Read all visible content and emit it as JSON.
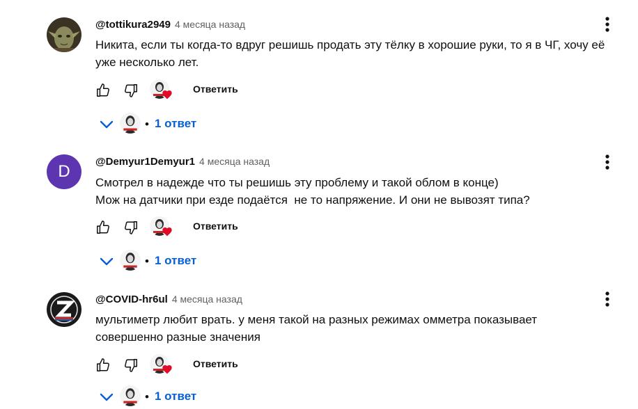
{
  "comments": [
    {
      "author": "@tottikura2949",
      "time": "4 месяца назад",
      "text": "Никита, если ты когда-то вдруг решишь продать эту тёлку в хорошие руки, то я в ЧГ, хочу её\nуже несколько лет.",
      "reply_label": "Ответить",
      "replies_label": "1 ответ",
      "avatar_icon": "yoda-avatar-icon"
    },
    {
      "author": "@Demyur1Demyur1",
      "time": "4 месяца назад",
      "text": "Смотрел в надежде что ты решишь эту проблему и такой облом в конце)\nМож на датчики при езде подаётся  не то напряжение. И они не вывозят типа?",
      "reply_label": "Ответить",
      "replies_label": "1 ответ",
      "avatar_letter": "D",
      "avatar_color": "#5e35b1"
    },
    {
      "author": "@COVID-hr6ul",
      "time": "4 месяца назад",
      "text": "мультиметр любит врать. у меня такой на разных режимах омметра показывает\nсовершенно разные значения",
      "reply_label": "Ответить",
      "replies_label": "1 ответ",
      "avatar_icon": "z-logo-avatar-icon"
    }
  ],
  "separator": "•",
  "colors": {
    "link_blue": "#065fd4",
    "heart_red": "#e00b28",
    "secondary_text": "#606060"
  }
}
